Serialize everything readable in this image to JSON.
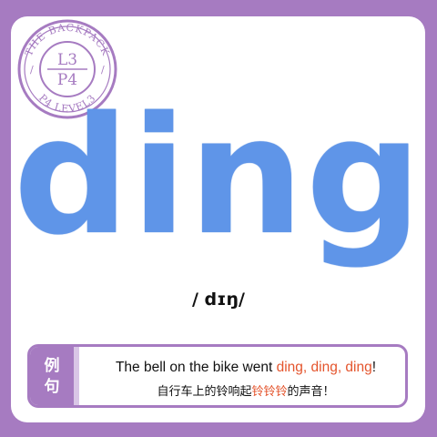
{
  "badge": {
    "ring_top_text": "THE BACKPACK",
    "ring_bottom_text": "P4 LEVEL3",
    "separators": [
      "/",
      "/"
    ],
    "center_line1": "L3",
    "center_line2": "P4"
  },
  "word": {
    "text": "ding",
    "color": "#5f95e8"
  },
  "phonetic": "/ dɪŋ/",
  "example": {
    "tag_line1": "例",
    "tag_line2": "句",
    "english": {
      "before": "The bell on the bike went ",
      "highlight": "ding, ding, ding",
      "after": "!"
    },
    "chinese": {
      "before": "自行车上的铃响起",
      "highlight": "铃铃铃",
      "after": "的声音！"
    },
    "highlight_color": "#e4542c",
    "accent_color": "#a67bc1"
  }
}
